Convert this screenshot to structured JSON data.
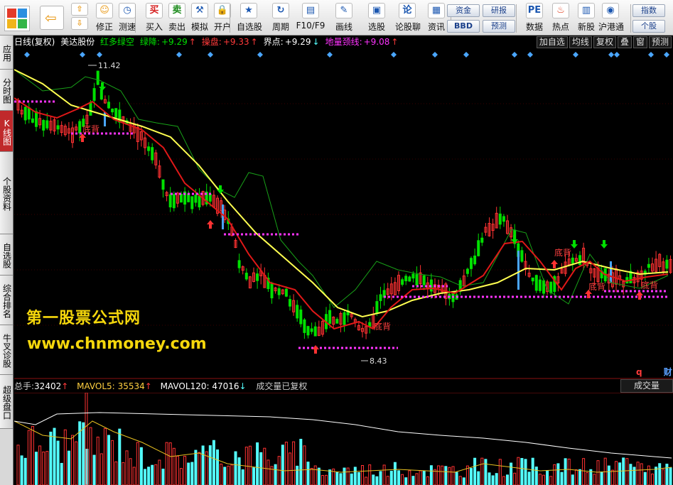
{
  "toolbar": {
    "buttons": [
      {
        "label": "修正",
        "icon": "smile-icon"
      },
      {
        "label": "测速",
        "icon": "clock-icon"
      },
      {
        "label": "买入",
        "icon": "buy-icon",
        "glyph": "买"
      },
      {
        "label": "卖出",
        "icon": "sell-icon",
        "glyph": "卖"
      },
      {
        "label": "模拟",
        "icon": "hammer-icon"
      },
      {
        "label": "开户",
        "icon": "lock-icon"
      },
      {
        "label": "自选股",
        "icon": "star-icon"
      },
      {
        "label": "周期",
        "icon": "cycle-icon"
      },
      {
        "label": "F10/F9",
        "icon": "f10-icon"
      },
      {
        "label": "画线",
        "icon": "pencil-icon"
      },
      {
        "label": "选股",
        "icon": "screen-icon"
      },
      {
        "label": "论股聊",
        "icon": "chat-icon",
        "glyph": "论"
      },
      {
        "label": "资讯",
        "icon": "news-icon"
      },
      {
        "label": "数据",
        "icon": "pe-icon",
        "glyph": "PE"
      },
      {
        "label": "热点",
        "icon": "hot-icon"
      },
      {
        "label": "新股",
        "icon": "newstock-icon"
      },
      {
        "label": "沪港通",
        "icon": "hk-connect-icon"
      }
    ],
    "pills": [
      "资金",
      "BBD",
      "研报",
      "预测",
      "指数",
      "个股"
    ]
  },
  "left_tabs": [
    {
      "label": "应用",
      "active": false
    },
    {
      "label": "分时图",
      "active": false
    },
    {
      "label": "K线图",
      "active": true
    },
    {
      "label": "个股资料",
      "active": false
    },
    {
      "label": "自选股",
      "active": false
    },
    {
      "label": "综合排名",
      "active": false
    },
    {
      "label": "牛叉诊股",
      "active": false
    },
    {
      "label": "超级盘口",
      "active": false
    }
  ],
  "chart_header": {
    "period": "日线(复权)",
    "stock_name": "美达股份",
    "indicator": "红多绿空",
    "ind_items": [
      {
        "label": "绿降:",
        "value": "+9.29",
        "arrow": "↑",
        "color": "#00e000"
      },
      {
        "label": "操盘:",
        "value": "+9.33",
        "arrow": "↑",
        "color": "#ff3a3a"
      },
      {
        "label": "界点:",
        "value": "+9.29",
        "arrow": "↓",
        "color": "#ffffff"
      },
      {
        "label": "地量颈线:",
        "value": "+9.08",
        "arrow": "↑",
        "color": "#ff33ff"
      }
    ],
    "right_buttons": [
      "加自选",
      "均线",
      "复权",
      "叠",
      "窗",
      "预测"
    ]
  },
  "price_annotations": {
    "high": "11.42",
    "low": "8.43",
    "signal_label": "底背"
  },
  "volume_header": {
    "total_label": "总手:",
    "total_value": "32402",
    "total_arrow": "↑",
    "ma5_label": "MAVOL5:",
    "ma5_value": "35534",
    "ma5_arrow": "↑",
    "ma120_label": "MAVOL120:",
    "ma120_value": "47016",
    "ma120_arrow": "↓",
    "note": "成交量已复权",
    "panel_label": "成交量"
  },
  "watermark": {
    "title": "第一股票公式网",
    "url": "www.chnmoney.com"
  },
  "right_marks": [
    "q",
    "财"
  ],
  "colors": {
    "up": "#ff3232",
    "down": "#00e000",
    "ma_short": "#e01818",
    "ma_long": "#ffff50",
    "neckline": "#ff33ff",
    "volume_up": "#ff3232",
    "volume_down": "#54ffff"
  }
}
